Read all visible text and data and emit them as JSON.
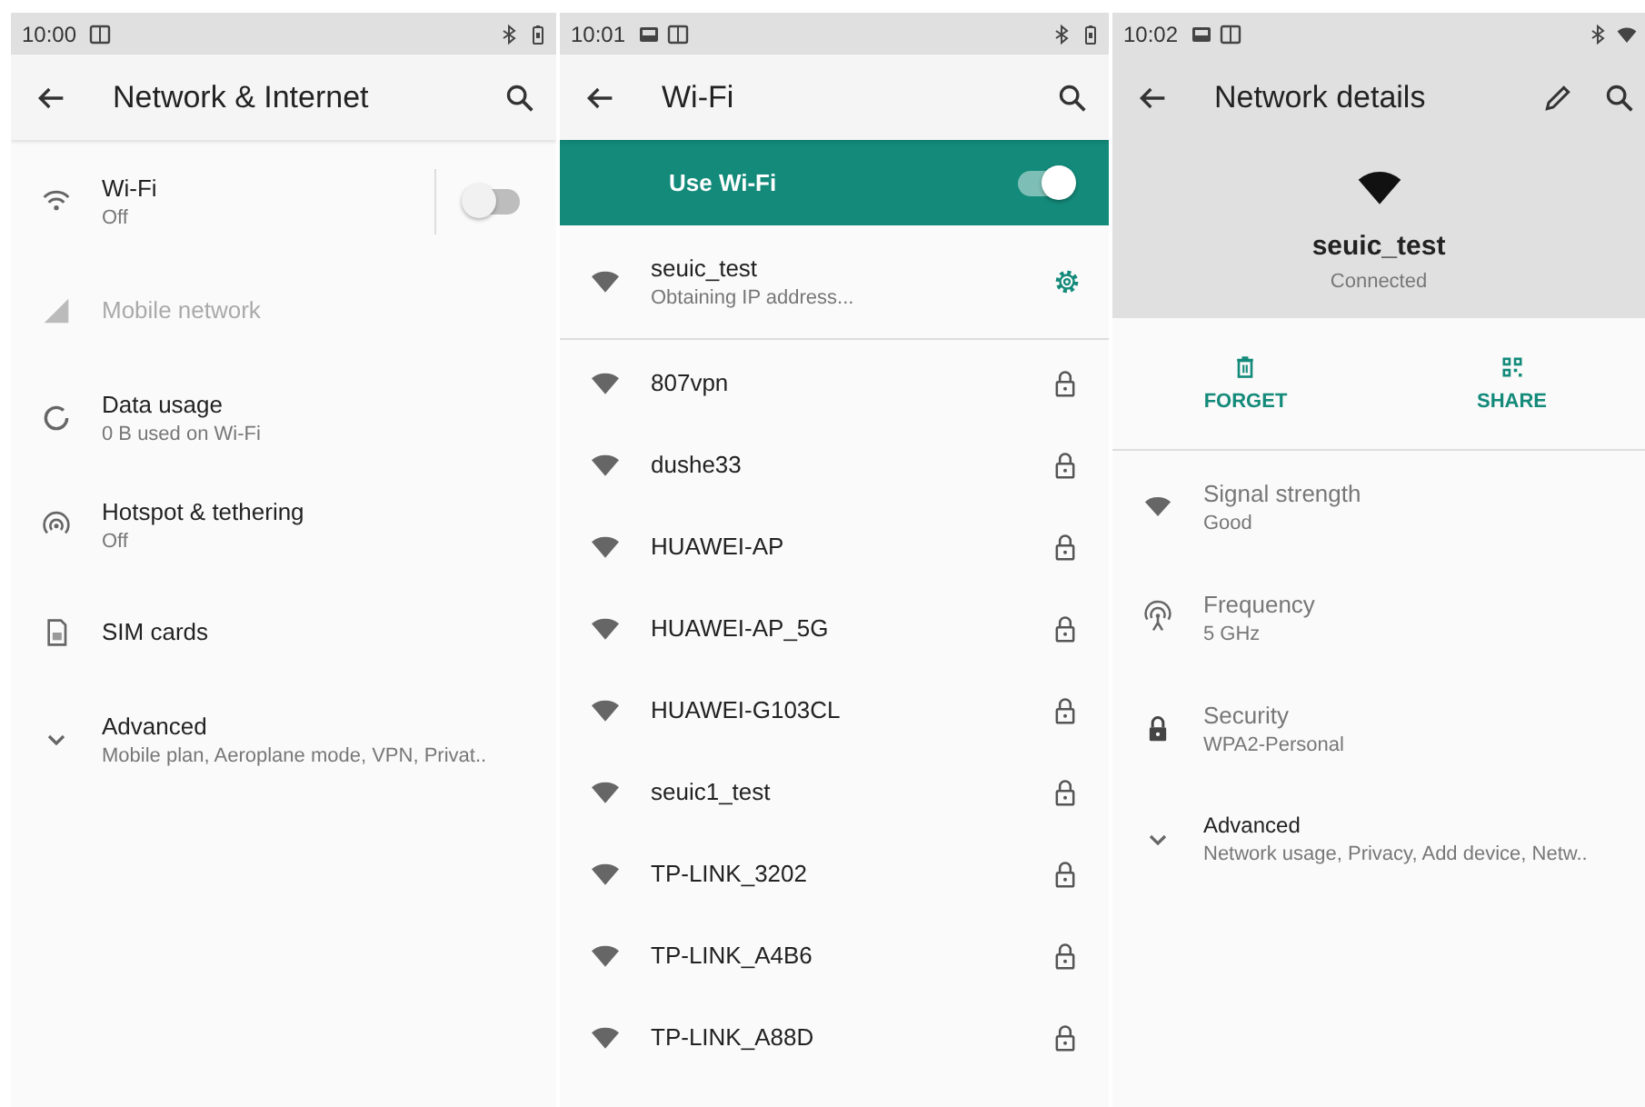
{
  "network_internet": {
    "status_bar": {
      "time": "10:00",
      "notifications": [
        {
          "kind": "panel"
        }
      ],
      "wifi": false
    },
    "title": "Network & Internet",
    "items": [
      {
        "title": "Wi-Fi",
        "summary": "Off",
        "kind": "switch",
        "on": false,
        "disabled": false
      },
      {
        "title": "Mobile network",
        "kind": "plain",
        "disabled": true
      },
      {
        "title": "Data usage",
        "summary": "0 B used on Wi-Fi",
        "kind": "plain",
        "disabled": false
      },
      {
        "title": "Hotspot & tethering",
        "summary": "Off",
        "kind": "plain",
        "disabled": false
      },
      {
        "title": "SIM cards",
        "kind": "plain",
        "disabled": false
      },
      {
        "title": "Advanced",
        "summary": "Mobile plan, Aeroplane mode, VPN, Privat..",
        "kind": "expand",
        "disabled": false
      }
    ]
  },
  "wifi": {
    "status_bar": {
      "time": "10:01",
      "notifications": [
        {
          "kind": "image"
        },
        {
          "kind": "panel"
        }
      ],
      "wifi": false
    },
    "title": "Wi-Fi",
    "master_switch": {
      "label": "Use Wi-Fi",
      "on": true
    },
    "networks": [
      {
        "name": "seuic_test",
        "status": "Obtaining IP address...",
        "kind": "current"
      },
      {
        "name": "807vpn",
        "kind": "secured"
      },
      {
        "name": "dushe33",
        "kind": "secured"
      },
      {
        "name": "HUAWEI-AP",
        "kind": "secured"
      },
      {
        "name": "HUAWEI-AP_5G",
        "kind": "secured"
      },
      {
        "name": "HUAWEI-G103CL",
        "kind": "secured"
      },
      {
        "name": "seuic1_test",
        "kind": "secured"
      },
      {
        "name": "TP-LINK_3202",
        "kind": "secured"
      },
      {
        "name": "TP-LINK_A4B6",
        "kind": "secured"
      },
      {
        "name": "TP-LINK_A88D",
        "kind": "secured"
      }
    ]
  },
  "network_details": {
    "status_bar": {
      "time": "10:02",
      "notifications": [
        {
          "kind": "image"
        },
        {
          "kind": "panel"
        }
      ],
      "wifi": true
    },
    "title": "Network details",
    "network_name": "seuic_test",
    "network_status": "Connected",
    "actions": [
      "FORGET",
      "SHARE"
    ],
    "details": [
      {
        "label": "Signal strength",
        "value": "Good"
      },
      {
        "label": "Frequency",
        "value": "5 GHz"
      },
      {
        "label": "Security",
        "value": "WPA2-Personal"
      }
    ],
    "advanced": {
      "title": "Advanced",
      "summary": "Network usage, Privacy, Add device, Netw.."
    }
  }
}
